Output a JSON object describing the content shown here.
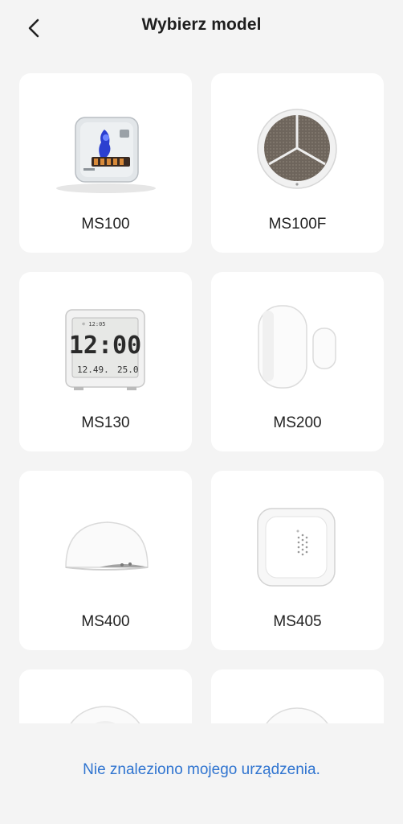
{
  "header": {
    "title": "Wybierz model"
  },
  "models": [
    {
      "label": "MS100",
      "icon": "ms100-sensor-image"
    },
    {
      "label": "MS100F",
      "icon": "ms100f-sensor-image"
    },
    {
      "label": "MS130",
      "icon": "ms130-clock-image"
    },
    {
      "label": "MS200",
      "icon": "ms200-door-sensor-image"
    },
    {
      "label": "MS400",
      "icon": "ms400-leak-sensor-image"
    },
    {
      "label": "MS405",
      "icon": "ms405-sensor-image"
    },
    {
      "label": "",
      "icon": "round-sensor-image"
    },
    {
      "label": "",
      "icon": "round-sensor-image"
    }
  ],
  "footer": {
    "link_text": "Nie znaleziono mojego urządzenia."
  },
  "colors": {
    "background": "#f4f4f4",
    "card": "#ffffff",
    "link": "#2f74d0"
  }
}
